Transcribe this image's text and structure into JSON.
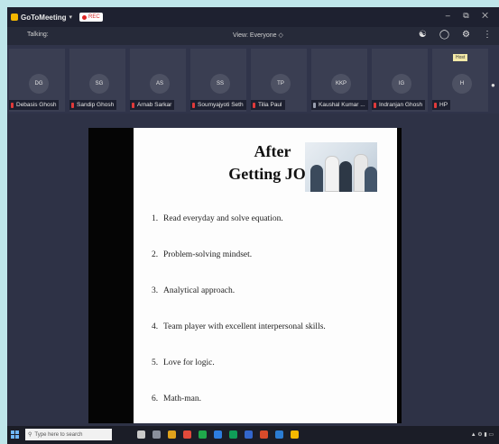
{
  "window": {
    "app_name": "GoToMeeting",
    "recording_label": "REC",
    "controls": "–  ⧉  ✕"
  },
  "toolbar": {
    "talking_label": "Talking:",
    "view_mode": "View: Everyone ◇"
  },
  "participants": [
    {
      "initials": "DG",
      "name": "Debasis Ghosh"
    },
    {
      "initials": "SG",
      "name": "Sandip Ghosh"
    },
    {
      "initials": "AS",
      "name": "Arnab Sarkar"
    },
    {
      "initials": "SS",
      "name": "Soumyajyoti Seth"
    },
    {
      "initials": "TP",
      "name": "Tilia Paul"
    },
    {
      "initials": "KKP",
      "name": "Kaushal Kumar ..."
    },
    {
      "initials": "IG",
      "name": "Indranjan Ghosh"
    },
    {
      "initials": "H",
      "name": "HP"
    }
  ],
  "host_tag": "Host",
  "slide": {
    "title_line1": "After",
    "title_line2": "Getting JOB",
    "bullets": [
      {
        "num": "1.",
        "text": "Read everyday and solve equation."
      },
      {
        "num": "2.",
        "text": "Problem-solving mindset."
      },
      {
        "num": "3.",
        "text": "Analytical approach."
      },
      {
        "num": "4.",
        "text": "Team player with excellent interpersonal skills."
      },
      {
        "num": "5.",
        "text": "Love for logic."
      },
      {
        "num": "6.",
        "text": "Math-man."
      }
    ]
  },
  "taskbar": {
    "search_placeholder": "Type here to search"
  },
  "colors": {
    "rec_red": "#e02424",
    "mic_muted": "#e23a3a",
    "app_yellow": "#f5b800"
  }
}
